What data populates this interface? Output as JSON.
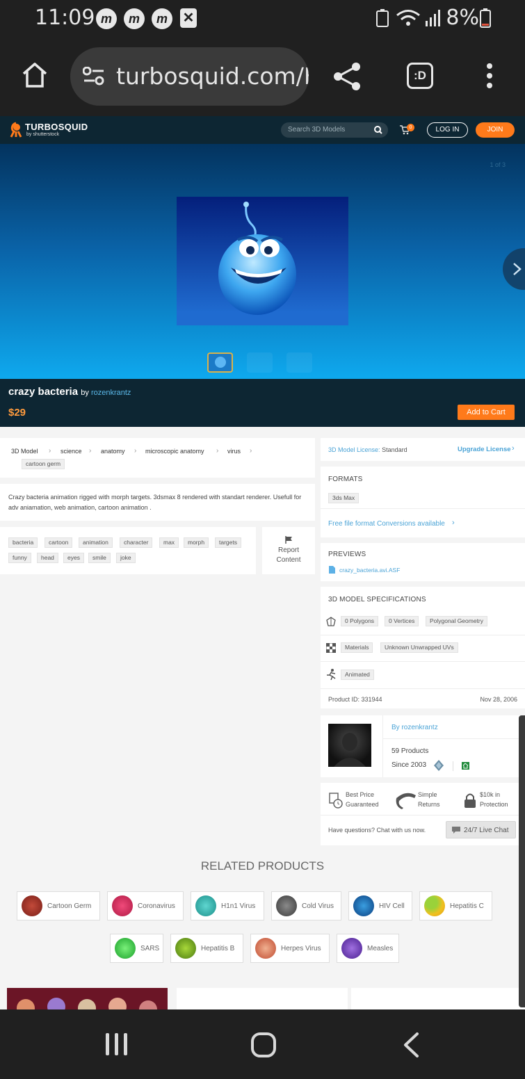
{
  "status_bar": {
    "time": "11:09",
    "notification_icons": [
      "m-app-icon",
      "m-app-icon",
      "m-app-icon",
      "close-notification-icon"
    ],
    "battery_percent": "8%"
  },
  "browser": {
    "url": "turbosquid.com/F"
  },
  "site_header": {
    "logo_text": "TURBOSQUID",
    "logo_sub": "by shutterstock",
    "search_placeholder": "Search 3D Models",
    "cart_count": "0",
    "login_label": "LOG IN",
    "join_label": "JOIN"
  },
  "hero": {
    "image_counter": "1 of 3"
  },
  "product": {
    "title": "crazy bacteria",
    "by_prefix": "by",
    "author": "rozenkrantz",
    "price": "$29",
    "add_to_cart": "Add to Cart"
  },
  "breadcrumb": [
    "3D Model",
    "science",
    "anatomy",
    "microscopic anatomy",
    "virus",
    "cartoon germ"
  ],
  "description": "Crazy bacteria animation rigged with morph targets. 3dsmax 8 rendered with standart renderer. Usefull for adv aniamation, web animation, cartoon animation .",
  "tags": [
    "bacteria",
    "cartoon",
    "animation",
    "character",
    "max",
    "morph",
    "targets",
    "funny",
    "head",
    "eyes",
    "smile",
    "joke"
  ],
  "report": {
    "line1": "Report",
    "line2": "Content"
  },
  "license": {
    "label": "3D Model License:",
    "value": "Standard",
    "upgrade": "Upgrade License"
  },
  "formats": {
    "title": "FORMATS",
    "items": [
      "3ds Max"
    ],
    "conversion_link": "Free file format Conversions available"
  },
  "previews": {
    "title": "PREVIEWS",
    "file": "crazy_bacteria.avi.ASF"
  },
  "specs": {
    "title": "3D MODEL SPECIFICATIONS",
    "row1": [
      "0 Polygons",
      "0 Vertices",
      "Polygonal Geometry"
    ],
    "row2": [
      "Materials",
      "Unknown Unwrapped UVs"
    ],
    "row3": [
      "Animated"
    ],
    "product_id": "Product ID: 331944",
    "date": "Nov 28, 2006"
  },
  "artist": {
    "by_line": "By rozenkrantz",
    "products": "59 Products",
    "since": "Since 2003"
  },
  "guarantees": {
    "best_price_1": "Best Price",
    "best_price_2": "Guaranteed",
    "returns_1": "Simple",
    "returns_2": "Returns",
    "protection_1": "$10k in",
    "protection_2": "Protection",
    "questions": "Have questions? Chat with us now.",
    "live_chat": "24/7 Live Chat"
  },
  "related": {
    "title": "RELATED PRODUCTS",
    "items": [
      "Cartoon Germ",
      "Coronavirus",
      "H1n1 Virus",
      "Cold Virus",
      "HIV Cell",
      "Hepatitis C",
      "SARS",
      "Hepatitis B",
      "Herpes Virus",
      "Measles"
    ]
  },
  "colors": {
    "accent_orange": "#ff7a1a",
    "header_dark": "#0d2633",
    "link_blue": "#4aa3d6"
  }
}
